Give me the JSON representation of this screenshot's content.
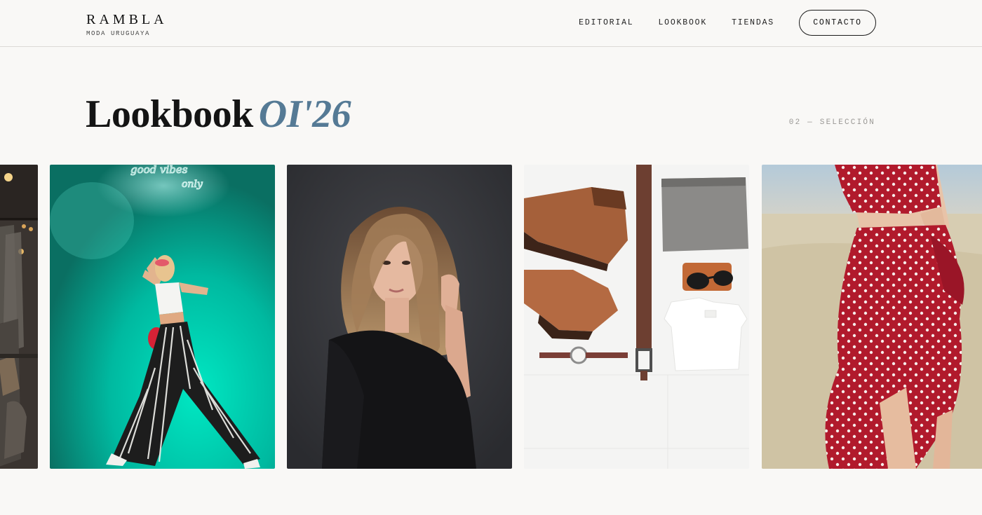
{
  "header": {
    "brand_name": "RAMBLA",
    "brand_tagline": "MODA URUGUAYA",
    "nav": {
      "editorial": "EDITORIAL",
      "lookbook": "LOOKBOOK",
      "tiendas": "TIENDAS",
      "contacto": "CONTACTO"
    }
  },
  "hero": {
    "title": "Lookbook",
    "title_accent": "OI'26",
    "section_label": "02 — SELECCIÓN"
  },
  "gallery": {
    "neon_sign_lines": [
      "good vibes",
      "only"
    ]
  },
  "colors": {
    "background": "#f9f8f6",
    "accent": "#557a95",
    "text": "#1a1a1a"
  }
}
